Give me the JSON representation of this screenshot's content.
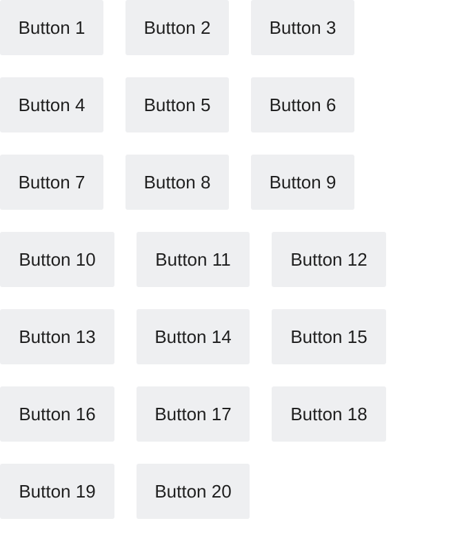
{
  "buttons": [
    {
      "label": "Button 1"
    },
    {
      "label": "Button 2"
    },
    {
      "label": "Button 3"
    },
    {
      "label": "Button 4"
    },
    {
      "label": "Button 5"
    },
    {
      "label": "Button 6"
    },
    {
      "label": "Button 7"
    },
    {
      "label": "Button 8"
    },
    {
      "label": "Button 9"
    },
    {
      "label": "Button 10"
    },
    {
      "label": "Button 11"
    },
    {
      "label": "Button 12"
    },
    {
      "label": "Button 13"
    },
    {
      "label": "Button 14"
    },
    {
      "label": "Button 15"
    },
    {
      "label": "Button 16"
    },
    {
      "label": "Button 17"
    },
    {
      "label": "Button 18"
    },
    {
      "label": "Button 19"
    },
    {
      "label": "Button 20"
    }
  ],
  "colors": {
    "button_background": "#eeeff1",
    "button_text": "#1f1f1f",
    "page_background": "#ffffff"
  }
}
